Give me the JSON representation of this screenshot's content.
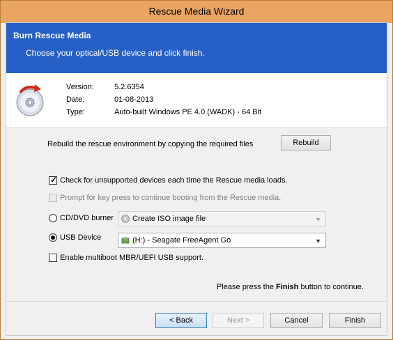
{
  "window": {
    "title": "Rescue Media Wizard"
  },
  "banner": {
    "heading": "Burn Rescue Media",
    "subheading": "Choose your optical/USB device and click finish."
  },
  "info": {
    "version_label": "Version:",
    "version_value": "5.2.6354",
    "date_label": "Date:",
    "date_value": "01-08-2013",
    "type_label": "Type:",
    "type_value": "Auto-built Windows PE 4.0 (WADK) - 64 Bit"
  },
  "rebuild": {
    "text": "Rebuild the rescue environment by copying the required files",
    "button": "Rebuild"
  },
  "options": {
    "check_unsupported": "Check for unsupported devices each time the Rescue media loads.",
    "prompt_key": "Prompt for key press to continue booting from the Rescue media.",
    "cd_label": "CD/DVD burner",
    "cd_value": "Create ISO image file",
    "usb_label": "USB Device",
    "usb_value": "(H:) - Seagate FreeAgent Go",
    "multiboot": "Enable multiboot MBR/UEFI USB support."
  },
  "footer": {
    "message_pre": "Please press the",
    "message_bold": "Finish",
    "message_post": "button to continue.",
    "back": "< Back",
    "next": "Next >",
    "cancel": "Cancel",
    "finish": "Finish"
  },
  "colors": {
    "banner": "#2660c6",
    "titlebar": "#eaa562"
  },
  "icons": {
    "disc": "disc-icon",
    "cd_drive": "cd-drive-icon",
    "usb_drive": "usb-drive-icon"
  }
}
